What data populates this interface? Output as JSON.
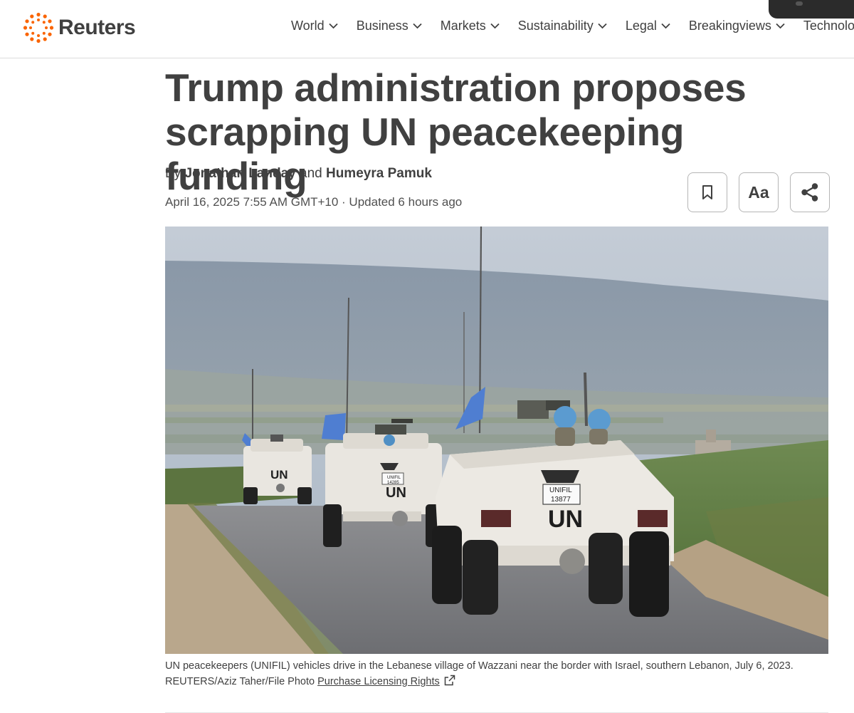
{
  "brand": {
    "name": "Reuters",
    "accent": "#fa6400"
  },
  "nav": {
    "items": [
      {
        "label": "World"
      },
      {
        "label": "Business"
      },
      {
        "label": "Markets"
      },
      {
        "label": "Sustainability"
      },
      {
        "label": "Legal"
      },
      {
        "label": "Breakingviews"
      },
      {
        "label": "Technology"
      }
    ],
    "dropdown_icon": "chevron-down-icon"
  },
  "article": {
    "headline": "Trump administration proposes scrapping UN peacekeeping funding",
    "byline": {
      "prefix": "By",
      "author1": "Jonathan Landay",
      "conjunction": "and",
      "author2": "Humeyra Pamuk"
    },
    "dateline": "April 16, 2025 7:55 AM GMT+10 · Updated 6 hours ago",
    "tools": {
      "bookmark_icon": "bookmark-icon",
      "text_size_label": "Aa",
      "share_icon": "share-icon"
    },
    "photo": {
      "vehicle_markings": [
        "UN",
        "UN",
        "UN"
      ],
      "plates": [
        "UNIFIL",
        "13877",
        "UNIFIL",
        "14285"
      ]
    },
    "caption": {
      "text": "UN peacekeepers (UNIFIL) vehicles drive in the Lebanese village of Wazzani near the border with Israel, southern Lebanon, July 6, 2023.",
      "credit": "REUTERS/Aziz Taher/File Photo",
      "rights_link": "Purchase Licensing Rights",
      "external_icon": "external-link-icon"
    }
  }
}
